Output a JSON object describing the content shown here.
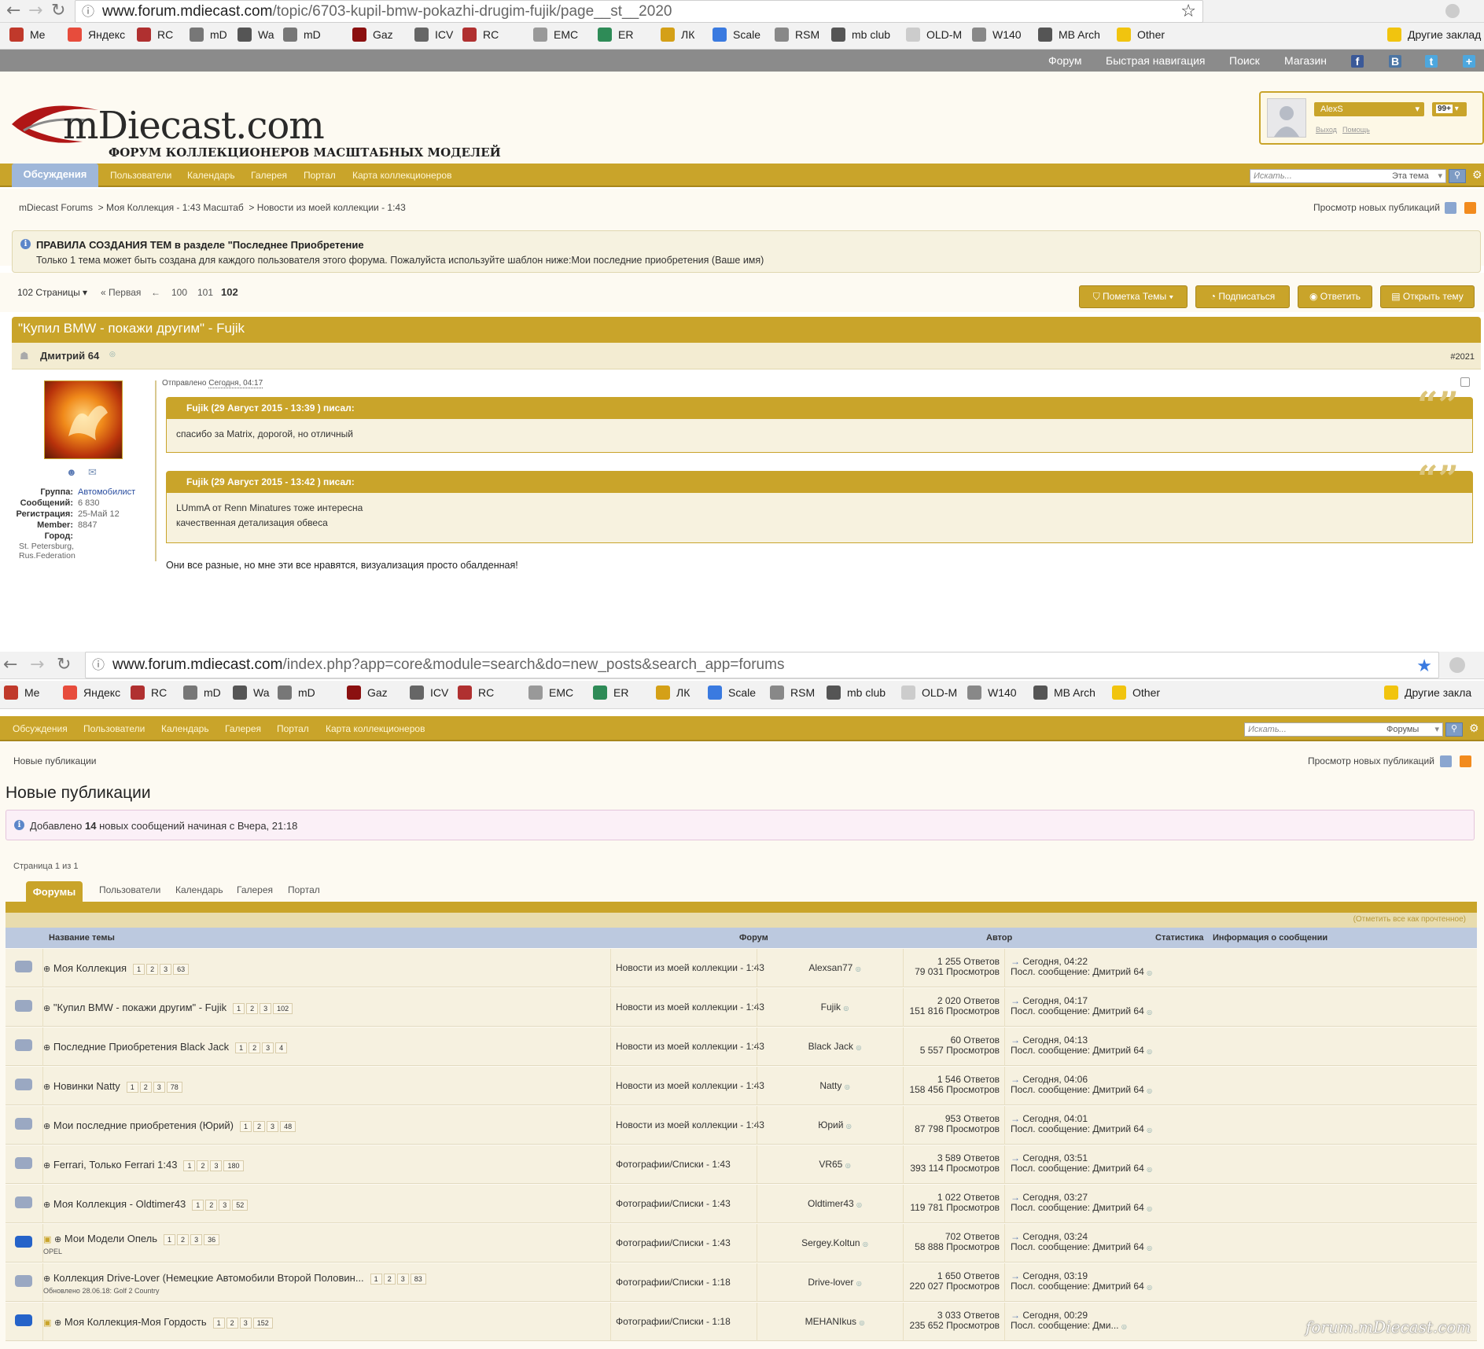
{
  "browser1": {
    "url_host": "www.forum.mdiecast.com",
    "url_path": "/topic/6703-kupil-bmw-pokazhi-drugim-fujik/page__st__2020"
  },
  "browser2": {
    "url_host": "www.forum.mdiecast.com",
    "url_path": "/index.php?app=core&module=search&do=new_posts&search_app=forums"
  },
  "bookmarks": [
    "Me",
    "Яндекс",
    "RC",
    "mD",
    "Wa",
    "mD",
    "Gaz",
    "ICV",
    "RC",
    "EMC",
    "ER",
    "ЛК",
    "Scale",
    "RSM",
    "mb club",
    "OLD-M",
    "W140",
    "MB Arch",
    "Other"
  ],
  "bookmarks_other": "Другие заклад",
  "bookmarks_other2": "Другие закла",
  "top_nav": [
    "Форум",
    "Быстрая навигация",
    "Поиск",
    "Магазин"
  ],
  "site": {
    "logo_main": "mDiecast.com",
    "logo_sub": "ФОРУМ КОЛЛЕКЦИОНЕРОВ МАСШТАБНЫХ МОДЕЛЕЙ",
    "user": "AlexS",
    "badge": "99+",
    "logout": "Выход",
    "help": "Помощь"
  },
  "main_nav": {
    "active": "Обсуждения",
    "items": [
      "Пользователи",
      "Календарь",
      "Галерея",
      "Портал",
      "Карта коллекционеров"
    ]
  },
  "search": {
    "placeholder": "Искать...",
    "scope1": "Эта тема",
    "scope2": "Форумы"
  },
  "crumbs1": [
    "mDiecast Forums",
    "Моя Коллекция - 1:43 Масштаб",
    "Новости из моей коллекции - 1:43"
  ],
  "view_new": "Просмотр новых публикаций",
  "rules": {
    "title": "ПРАВИЛА СОЗДАНИЯ ТЕМ в разделе \"Последнее Приобретение",
    "text": "Только 1 тема может быть создана для каждого пользователя этого форума. Пожалуйста используйте шаблон ниже:Мои последние приобретения (Ваше имя)"
  },
  "pagination": {
    "pages": "102 Страницы",
    "first": "« Первая",
    "prev": "←",
    "p1": "100",
    "p2": "101",
    "current": "102"
  },
  "buttons": {
    "mark": "Пометка Темы",
    "subscribe": "Подписаться",
    "reply": "Ответить",
    "new_topic": "Открыть тему"
  },
  "topic_title": "\"Купил BMW - покажи другим\" - Fujik",
  "post": {
    "author": "Дмитрий 64",
    "number": "#2021",
    "sent_label": "Отправлено",
    "sent_time": "Сегодня, 04:17",
    "quote1_head": "Fujik (29 Август 2015 - 13:39 ) писал:",
    "quote1_body": "спасибо за Matrix, дорогой, но отличный",
    "quote2_head": "Fujik (29 Август 2015 - 13:42 ) писал:",
    "quote2_line1": "LUmmA от Renn Minatures тоже интересна",
    "quote2_line2": "качественная детализация обвеса",
    "text": "Они все разные, но мне эти все нравятся, визуализация просто обалденная!",
    "group_k": "Группа:",
    "group_v": "Автомобилист",
    "msgs_k": "Сообщений:",
    "msgs_v": "6 830",
    "reg_k": "Регистрация:",
    "reg_v": "25-Май 12",
    "member_k": "Member:",
    "member_v": "8847",
    "city_k": "Город:",
    "city_v1": "St. Petersburg,",
    "city_v2": "Rus.Federation"
  },
  "crumbs2": "Новые публикации",
  "new_posts": {
    "title": "Новые публикации",
    "added_pre": "Добавлено",
    "added_count": "14",
    "added_post": "новых сообщений начиная с Вчера, 21:18",
    "page_of": "Страница 1 из 1",
    "tabs": [
      "Форумы",
      "Пользователи",
      "Календарь",
      "Галерея",
      "Портал"
    ],
    "mark_read": "(Отметить все как прочтенное)",
    "cols": [
      "Название темы",
      "Форум",
      "Автор",
      "Статистика",
      "Информация о сообщении"
    ],
    "rows": [
      {
        "title": "Моя Коллекция",
        "pages": [
          "1",
          "2",
          "3",
          "63"
        ],
        "forum": "Новости из моей коллекции - 1:43",
        "author": "Alexsan77",
        "replies": "1 255 Ответов",
        "views": "79 031 Просмотров",
        "time": "Сегодня, 04:22",
        "last": "Посл. сообщение: Дмитрий 64",
        "sub": ""
      },
      {
        "title": "\"Купил BMW - покажи другим\" - Fujik",
        "pages": [
          "1",
          "2",
          "3",
          "102"
        ],
        "forum": "Новости из моей коллекции - 1:43",
        "author": "Fujik",
        "replies": "2 020 Ответов",
        "views": "151 816 Просмотров",
        "time": "Сегодня, 04:17",
        "last": "Посл. сообщение: Дмитрий 64",
        "sub": ""
      },
      {
        "title": "Последние Приобретения Black Jack",
        "pages": [
          "1",
          "2",
          "3",
          "4"
        ],
        "forum": "Новости из моей коллекции - 1:43",
        "author": "Black Jack",
        "replies": "60 Ответов",
        "views": "5 557 Просмотров",
        "time": "Сегодня, 04:13",
        "last": "Посл. сообщение: Дмитрий 64",
        "sub": ""
      },
      {
        "title": "Новинки Natty",
        "pages": [
          "1",
          "2",
          "3",
          "78"
        ],
        "forum": "Новости из моей коллекции - 1:43",
        "author": "Natty",
        "replies": "1 546 Ответов",
        "views": "158 456 Просмотров",
        "time": "Сегодня, 04:06",
        "last": "Посл. сообщение: Дмитрий 64",
        "sub": ""
      },
      {
        "title": "Мои последние приобретения (Юрий)",
        "pages": [
          "1",
          "2",
          "3",
          "48"
        ],
        "forum": "Новости из моей коллекции - 1:43",
        "author": "Юрий",
        "replies": "953 Ответов",
        "views": "87 798 Просмотров",
        "time": "Сегодня, 04:01",
        "last": "Посл. сообщение: Дмитрий 64",
        "sub": ""
      },
      {
        "title": "Ferrari, Только Ferrari 1:43",
        "pages": [
          "1",
          "2",
          "3",
          "180"
        ],
        "forum": "Фотографии/Списки - 1:43",
        "author": "VR65",
        "replies": "3 589 Ответов",
        "views": "393 114 Просмотров",
        "time": "Сегодня, 03:51",
        "last": "Посл. сообщение: Дмитрий 64",
        "sub": ""
      },
      {
        "title": "Моя Коллекция - Oldtimer43",
        "pages": [
          "1",
          "2",
          "3",
          "52"
        ],
        "forum": "Фотографии/Списки - 1:43",
        "author": "Oldtimer43",
        "replies": "1 022 Ответов",
        "views": "119 781 Просмотров",
        "time": "Сегодня, 03:27",
        "last": "Посл. сообщение: Дмитрий 64",
        "sub": ""
      },
      {
        "title": "Мои Модели Опель",
        "pages": [
          "1",
          "2",
          "3",
          "36"
        ],
        "forum": "Фотографии/Списки - 1:43",
        "author": "Sergey.Koltun",
        "replies": "702 Ответов",
        "views": "58 888 Просмотров",
        "time": "Сегодня, 03:24",
        "last": "Посл. сообщение: Дмитрий 64",
        "sub": "OPEL"
      },
      {
        "title": "Коллекция Drive-Lover (Немецкие Автомобили Второй Половин...",
        "pages": [
          "1",
          "2",
          "3",
          "83"
        ],
        "forum": "Фотографии/Списки - 1:18",
        "author": "Drive-lover",
        "replies": "1 650 Ответов",
        "views": "220 027 Просмотров",
        "time": "Сегодня, 03:19",
        "last": "Посл. сообщение: Дмитрий 64",
        "sub": "Обновлено 28.06.18: Golf 2 Country"
      },
      {
        "title": "Моя Коллекция-Моя Гордость",
        "pages": [
          "1",
          "2",
          "3",
          "152"
        ],
        "forum": "Фотографии/Списки - 1:18",
        "author": "MEHANIkus",
        "replies": "3 033 Ответов",
        "views": "235 652 Просмотров",
        "time": "Сегодня, 00:29",
        "last": "Посл. сообщение: Дми...",
        "sub": ""
      }
    ]
  },
  "watermark": "forum.mDiecast.com"
}
